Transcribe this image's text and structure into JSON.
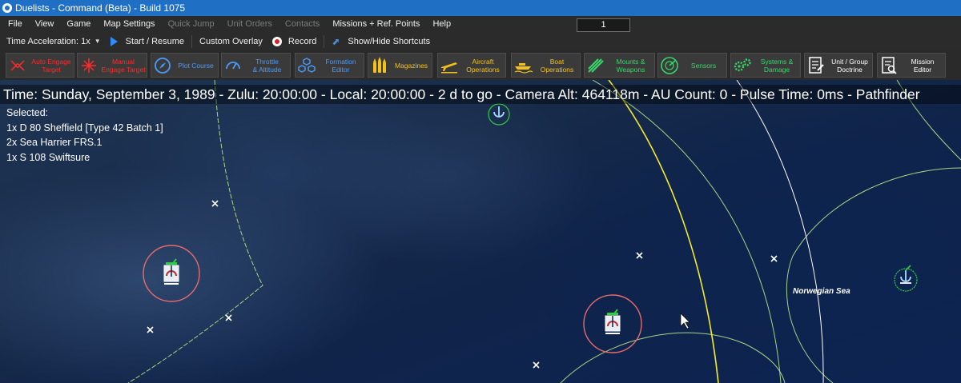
{
  "window": {
    "title": "Duelists - Command (Beta) - Build 1075"
  },
  "menu": {
    "items": [
      {
        "label": "File",
        "enabled": true
      },
      {
        "label": "View",
        "enabled": true
      },
      {
        "label": "Game",
        "enabled": true
      },
      {
        "label": "Map Settings",
        "enabled": true
      },
      {
        "label": "Quick Jump",
        "enabled": false
      },
      {
        "label": "Unit Orders",
        "enabled": false
      },
      {
        "label": "Contacts",
        "enabled": false
      },
      {
        "label": "Missions + Ref. Points",
        "enabled": true
      },
      {
        "label": "Help",
        "enabled": true
      }
    ],
    "pulse_value": "1"
  },
  "toolbar": {
    "time_acceleration_label": "Time Acceleration: 1x",
    "start_resume_label": "Start / Resume",
    "custom_overlay_label": "Custom Overlay",
    "record_label": "Record",
    "shortcuts_label": "Show/Hide Shortcuts"
  },
  "commands": [
    {
      "label": "Auto Engage\nTarget",
      "color": "#ff2a2a",
      "icon": "auto-engage-icon"
    },
    {
      "label": "Manual\nEngage Target",
      "color": "#ff2a2a",
      "icon": "manual-engage-icon"
    },
    {
      "label": "Plot Course",
      "color": "#4a9bff",
      "icon": "compass-icon"
    },
    {
      "label": "Throttle\n& Altitude",
      "color": "#4a9bff",
      "icon": "gauge-icon"
    },
    {
      "label": "Formation\nEditor",
      "color": "#4a9bff",
      "icon": "hexagons-icon"
    },
    {
      "label": "Magazines",
      "color": "#f2c21b",
      "icon": "ammo-icon"
    },
    {
      "label": "Aircraft\nOperations",
      "color": "#f2c21b",
      "icon": "aircraft-icon"
    },
    {
      "label": "Boat\nOperations",
      "color": "#f2c21b",
      "icon": "boat-icon"
    },
    {
      "label": "Mounts &\nWeapons",
      "color": "#38d66a",
      "icon": "weapons-icon"
    },
    {
      "label": "Sensors",
      "color": "#38d66a",
      "icon": "radar-icon"
    },
    {
      "label": "Systems &\nDamage",
      "color": "#38d66a",
      "icon": "gears-icon"
    },
    {
      "label": "Unit / Group\nDoctrine",
      "color": "#ffffff",
      "icon": "doctrine-icon"
    },
    {
      "label": "Mission\nEditor",
      "color": "#ffffff",
      "icon": "mission-editor-icon"
    }
  ],
  "map": {
    "status_line": "Time: Sunday, September 3, 1989 - Zulu: 20:00:00 - Local: 20:00:00 - 2 d to go -  Camera Alt: 464118m - AU Count: 0 - Pulse Time: 0ms - Pathfinder",
    "selected_heading": "Selected:",
    "selected_items": [
      "1x D 80 Sheffield [Type 42 Batch 1]",
      "2x Sea Harrier FRS.1",
      "1x S 108 Swiftsure"
    ],
    "region_label": "Norwegian Sea",
    "colors": {
      "range_ring_green": "#b8e88a",
      "range_ring_yellow": "#f5ea2a",
      "range_ring_white": "#ffffff",
      "hostile_ring": "#e86a6a",
      "friendly_ring": "#2ecc40"
    }
  }
}
